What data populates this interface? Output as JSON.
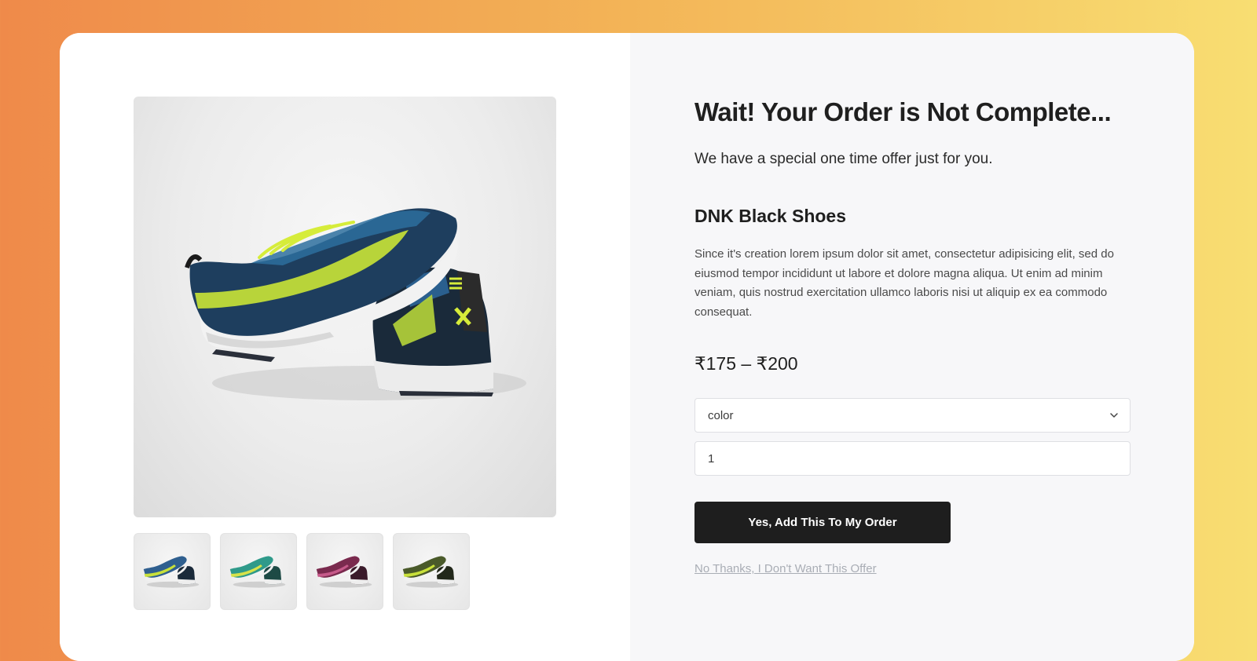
{
  "offer": {
    "headline": "Wait! Your Order is Not Complete...",
    "subline": "We have a special one time offer just for you."
  },
  "product": {
    "name": "DNK Black Shoes",
    "description": "Since it's creation lorem ipsum dolor sit amet, consectetur adipisicing elit, sed do eiusmod tempor incididunt ut labore et dolore magna aliqua. Ut enim ad minim veniam, quis nostrud exercitation ullamco laboris nisi ut aliquip ex ea commodo consequat.",
    "price": "₹175 – ₹200",
    "main_image_icon": "running-shoes-image",
    "thumbnails": [
      {
        "icon": "shoe-thumbnail-blue",
        "accent": "#2f5f8f",
        "lace": "#c8e03a"
      },
      {
        "icon": "shoe-thumbnail-teal",
        "accent": "#2f9a8a",
        "lace": "#d6e24a"
      },
      {
        "icon": "shoe-thumbnail-purple",
        "accent": "#7a2a4e",
        "lace": "#e8e8e8"
      },
      {
        "icon": "shoe-thumbnail-olive",
        "accent": "#4a5a2a",
        "lace": "#c8e03a"
      }
    ]
  },
  "form": {
    "color_select": {
      "value": "color",
      "icon": "chevron-down-icon"
    },
    "quantity": {
      "value": "1"
    }
  },
  "actions": {
    "accept_label": "Yes, Add This To My Order",
    "decline_label": "No Thanks, I Don't Want This Offer"
  },
  "colors": {
    "primary_button": "#1e1e1e",
    "background_gradient_start": "#ef8a4a",
    "background_gradient_end": "#f8de72",
    "right_panel": "#f7f7f9",
    "decline_link": "#a9adb5"
  }
}
